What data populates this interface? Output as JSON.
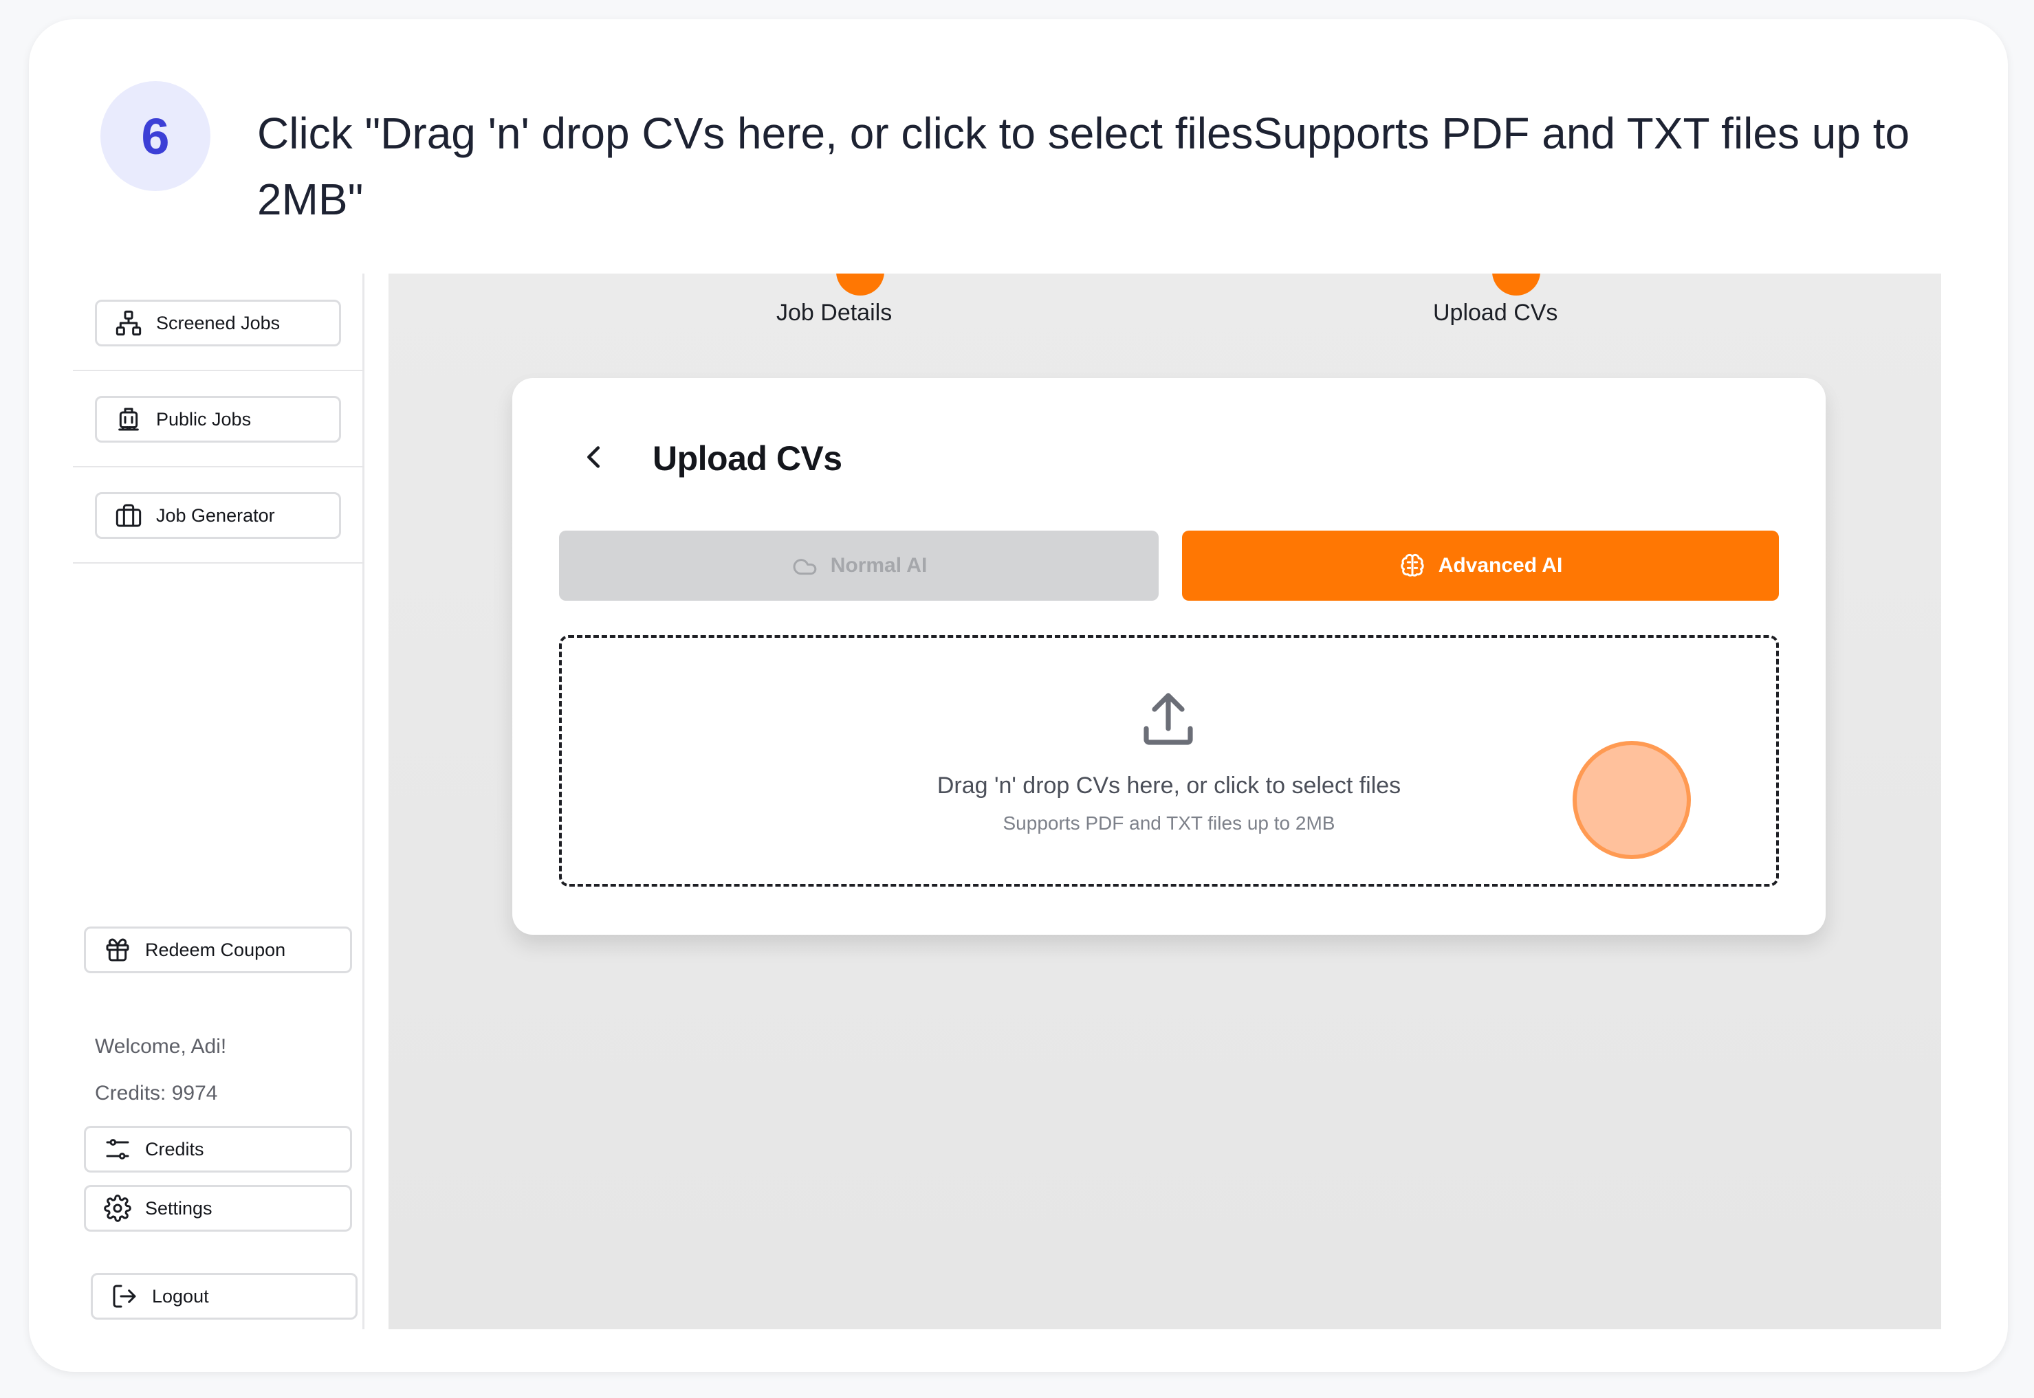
{
  "instruction": {
    "step_number": "6",
    "text": "Click \"Drag 'n' drop CVs here, or click to select filesSupports PDF and TXT files up to 2MB\""
  },
  "sidebar": {
    "nav": [
      {
        "label": "Screened Jobs",
        "icon": "sitemap-icon"
      },
      {
        "label": "Public Jobs",
        "icon": "luggage-icon"
      },
      {
        "label": "Job Generator",
        "icon": "briefcase-icon"
      }
    ],
    "redeem_label": "Redeem Coupon",
    "welcome": "Welcome, Adi!",
    "credits_text": "Credits: 9974",
    "credits_label": "Credits",
    "settings_label": "Settings",
    "logout_label": "Logout"
  },
  "stepper": {
    "steps": [
      {
        "label": "Job Details"
      },
      {
        "label": "Upload CVs"
      }
    ]
  },
  "panel": {
    "title": "Upload CVs",
    "mode_normal": "Normal AI",
    "mode_advanced": "Advanced AI",
    "drop_main": "Drag 'n' drop CVs here, or click to select files",
    "drop_sub": "Supports PDF and TXT files up to 2MB"
  },
  "colors": {
    "accent": "#ff7703",
    "badge_bg": "#e9ebfd",
    "badge_text": "#3c3fd6",
    "click_marker": "#ffb080"
  }
}
